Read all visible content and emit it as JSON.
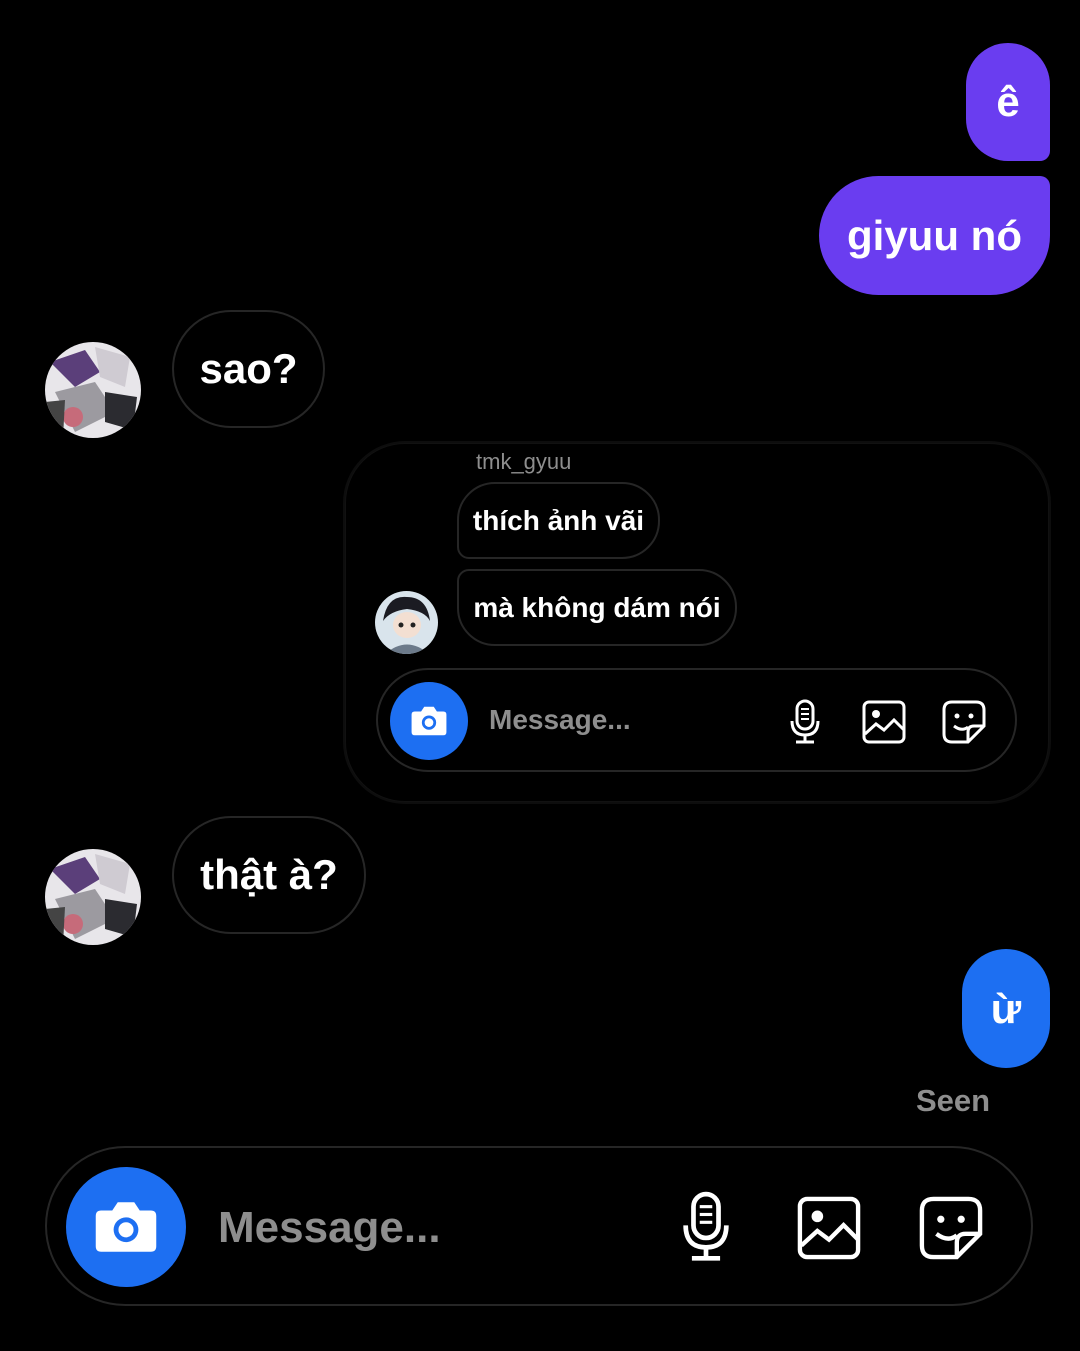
{
  "thread": {
    "messages": [
      {
        "from": "me",
        "text": "ê",
        "color": "#6a3df0"
      },
      {
        "from": "me",
        "text": "giyuu nó",
        "color": "#6a3df0"
      },
      {
        "from": "them",
        "text": "sao?"
      },
      {
        "from": "them",
        "text": "thật à?"
      },
      {
        "from": "me",
        "text": "ừ",
        "color": "#1d6ff2"
      }
    ],
    "seen_label": "Seen"
  },
  "shared_screenshot": {
    "username": "tmk_gyuu",
    "messages": [
      "thích ảnh vãi",
      "mà không dám nói"
    ],
    "composer_placeholder": "Message..."
  },
  "composer": {
    "placeholder": "Message...",
    "icons": [
      "camera-icon",
      "microphone-icon",
      "gallery-icon",
      "sticker-icon"
    ],
    "accent": "#1d6ff2"
  }
}
